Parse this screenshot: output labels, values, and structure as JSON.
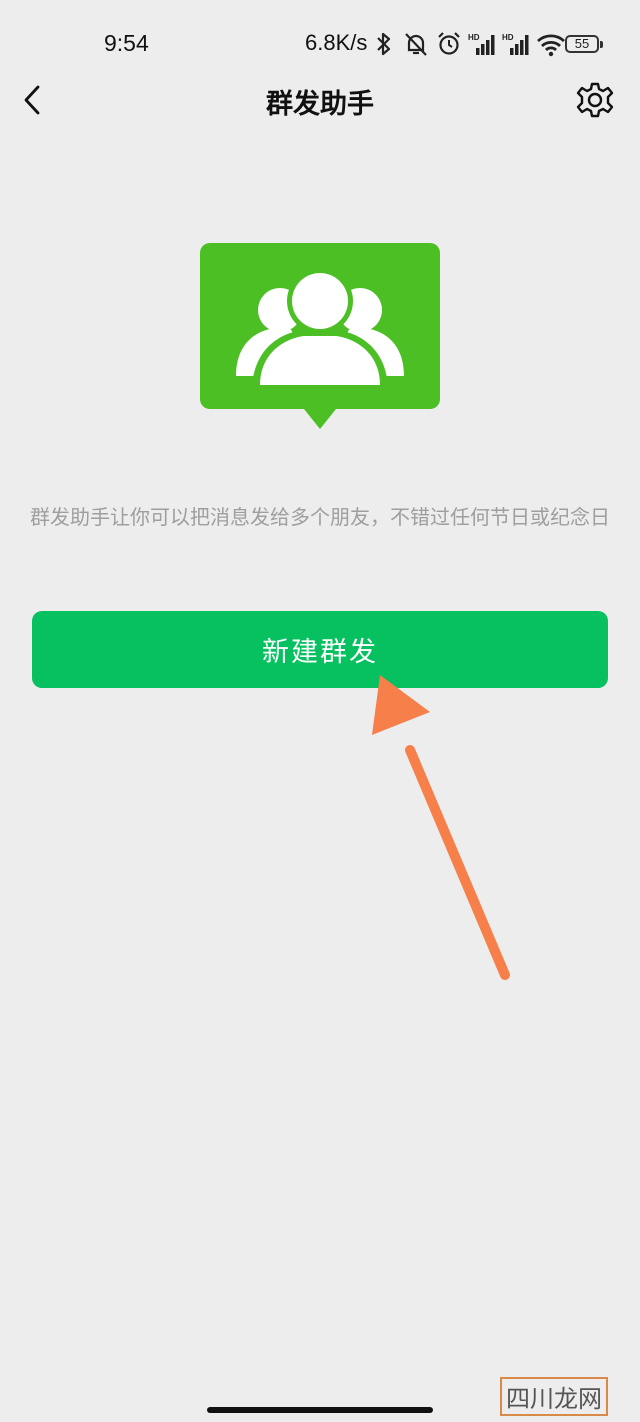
{
  "status_bar": {
    "time": "9:54",
    "network_speed": "6.8K/s",
    "battery_level": "55",
    "icons": [
      "bluetooth-icon",
      "muted-bell-icon",
      "alarm-icon",
      "signal-hd-icon",
      "signal-hd-icon",
      "wifi-icon",
      "battery-icon"
    ]
  },
  "nav": {
    "title": "群发助手",
    "back_icon": "chevron-left-icon",
    "settings_icon": "gear-icon"
  },
  "hero": {
    "icon": "group-people-icon",
    "color": "#4bbf24"
  },
  "main": {
    "description": "群发助手让你可以把消息发给多个朋友，不错过任何节日或纪念日",
    "new_broadcast_label": "新建群发",
    "button_color": "#07c160"
  },
  "annotation": {
    "arrow_color": "#f67f4a"
  },
  "watermark": {
    "brand": "四川龙网"
  }
}
